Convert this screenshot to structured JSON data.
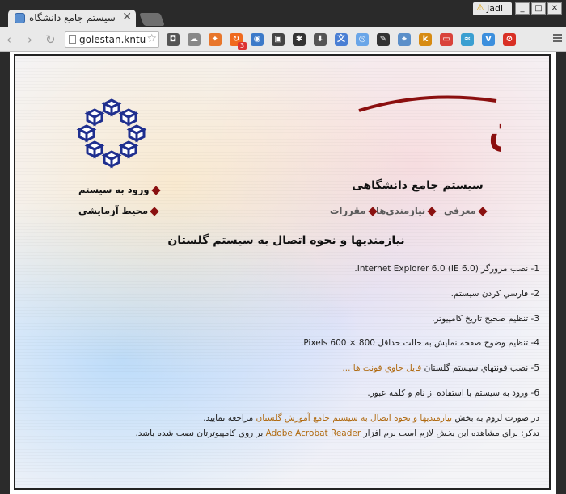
{
  "browser": {
    "tab_title": "سیستم جامع دانشگاه",
    "tab_close": "✕",
    "profile_warn": "⚠",
    "profile_name": "Jadi",
    "url": "golestan.kntu",
    "back_glyph": "‹",
    "forward_glyph": "›",
    "reload_glyph": "↻",
    "star_glyph": "☆",
    "extension_badge": "3",
    "window_min": "_",
    "window_max": "□",
    "window_close": "✕"
  },
  "extensions": [
    {
      "name": "pocket-icon",
      "color": "#555555",
      "glyph": "◘"
    },
    {
      "name": "cloud-icon",
      "color": "#888888",
      "glyph": "☁"
    },
    {
      "name": "fox-icon",
      "color": "#e8762b",
      "glyph": "✦"
    },
    {
      "name": "sync-icon",
      "color": "#f06a1e",
      "glyph": "↻"
    },
    {
      "name": "owl-icon",
      "color": "#3c7ac9",
      "glyph": "◉"
    },
    {
      "name": "film-icon",
      "color": "#444444",
      "glyph": "▣"
    },
    {
      "name": "asterisk-icon",
      "color": "#333333",
      "glyph": "✱"
    },
    {
      "name": "download-icon",
      "color": "#555555",
      "glyph": "⬇"
    },
    {
      "name": "translate-icon",
      "color": "#4a7fd4",
      "glyph": "文"
    },
    {
      "name": "camera-icon",
      "color": "#6aa6e8",
      "glyph": "◎"
    },
    {
      "name": "pen-icon",
      "color": "#333333",
      "glyph": "✎"
    },
    {
      "name": "mouse-icon",
      "color": "#5b8fc9",
      "glyph": "⌖"
    },
    {
      "name": "k-icon",
      "color": "#d78b12",
      "glyph": "k"
    },
    {
      "name": "screen-icon",
      "color": "#d9433a",
      "glyph": "▭"
    },
    {
      "name": "wave-icon",
      "color": "#3a9fd1",
      "glyph": "≈"
    },
    {
      "name": "v-icon",
      "color": "#3c8fdd",
      "glyph": "V"
    },
    {
      "name": "stop-icon",
      "color": "#d93025",
      "glyph": "⊘"
    }
  ],
  "site": {
    "brand": "گلستان",
    "subtitle": "سیستم جامع دانشگاهی",
    "nav": {
      "login": "ورود به سیستم",
      "test_env": "محیط آزمایشی",
      "intro": "معرفی",
      "requirements": "نیازمندی‌ها",
      "regulations": "مقررات"
    },
    "heading": "نیازمندیها و نحوه اتصال به سیستم گلستان",
    "requirements": [
      {
        "prefix": "1- نصب مرورگر ",
        "ltr": "Internet Explorer 6.0 (IE 6.0)",
        "suffix": "."
      },
      {
        "text": "2- فارسي كردن سيستم."
      },
      {
        "text": "3- تنظيم صحيح تاريخ كامپيوتر."
      },
      {
        "prefix": "4- تنظيم وضوح صفحه نمايش به حالت حداقل ",
        "ltr": "Pixels 600 × 800",
        "suffix": "."
      },
      {
        "prefix": "5- نصب فونتهاي سيستم گلستان ",
        "link": "فايل حاوي فونت ها ..."
      },
      {
        "text": "6- ورود به سيستم با استفاده از نام و كلمه عبور."
      }
    ],
    "footer1": {
      "prefix": "در صورت لزوم به بخش ",
      "link": "نيازمنديها و نحوه اتصال به سيستم جامع آموزش گلستان",
      "suffix": " مراجعه نماييد."
    },
    "footer2": {
      "prefix": "تذكر: براي مشاهده اين بخش لازم است نرم افزار ",
      "link": "Adobe Acrobat Reader",
      "suffix": " بر روي كامپيوترتان نصب شده باشد."
    }
  },
  "colors": {
    "bullet": "#8a1010",
    "brand": "#8b0f0f",
    "logo": "#1f2f8f",
    "link": "#b06a10"
  }
}
